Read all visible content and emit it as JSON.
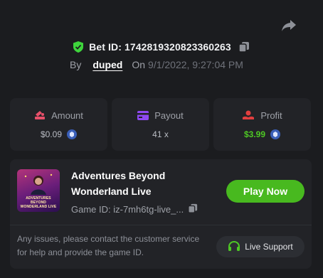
{
  "bet": {
    "id_label": "Bet ID: 1742819320823360263",
    "by_label": "By",
    "username": "duped",
    "on_label": "On",
    "date": "9/1/2022, 9:27:04 PM"
  },
  "stats": {
    "amount": {
      "label": "Amount",
      "value": "$0.09",
      "icon": "coins-icon",
      "color": "#e8506a"
    },
    "payout": {
      "label": "Payout",
      "value": "41 x",
      "icon": "card-icon",
      "color": "#8f49f2"
    },
    "profit": {
      "label": "Profit",
      "value": "$3.99",
      "icon": "profit-icon",
      "color": "#e23f3f",
      "value_color": "#4ec824"
    }
  },
  "game": {
    "title": "Adventures Beyond Wonderland Live",
    "thumbnail_text": "ADVENTURES BEYOND WONDERLAND LIVE",
    "id_label": "Game ID: iz-7mh6tg-live_...",
    "play_label": "Play Now",
    "help_text": "Any issues, please contact the customer service for help and provide the game ID.",
    "support_label": "Live Support"
  },
  "colors": {
    "background": "#1b1c1f",
    "card": "#222327",
    "accent_green": "#48b91f",
    "verified": "#3ed43c"
  }
}
